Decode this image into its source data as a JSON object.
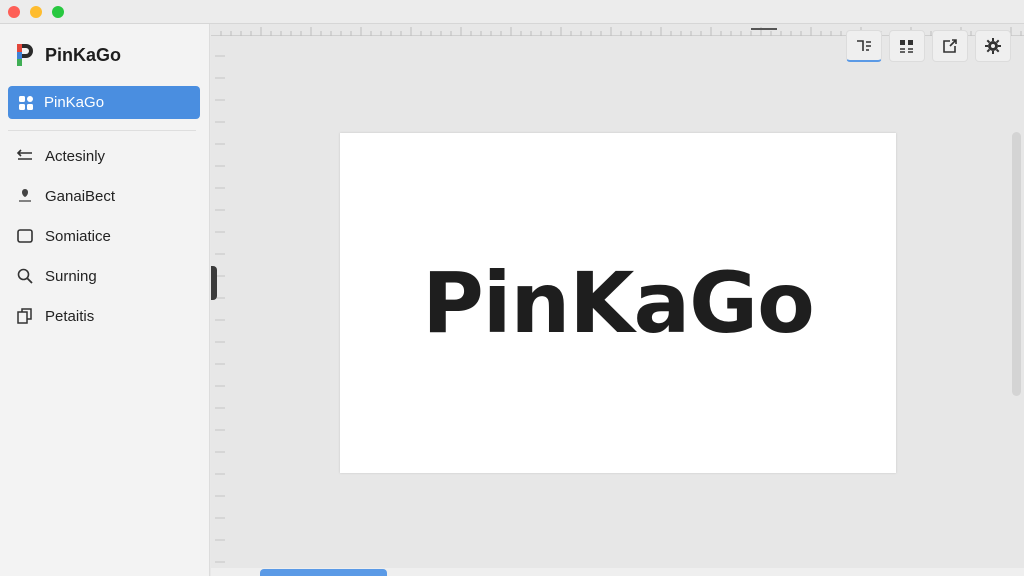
{
  "app": {
    "name": "PinKaGo"
  },
  "sidebar": {
    "active": {
      "label": "PinKaGo",
      "icon": "grid-icon"
    },
    "items": [
      {
        "label": "Actesinly",
        "icon": "arrow-left-lines-icon"
      },
      {
        "label": "GanaiBect",
        "icon": "pin-icon"
      },
      {
        "label": "Somiatice",
        "icon": "square-icon"
      },
      {
        "label": "Surning",
        "icon": "search-icon"
      },
      {
        "label": "Petaitis",
        "icon": "copy-icon"
      }
    ]
  },
  "canvas": {
    "text": "PinKaGo"
  },
  "toolbar": {
    "buttons": [
      {
        "icon": "text-align-icon",
        "active": true
      },
      {
        "icon": "columns-icon",
        "active": false
      },
      {
        "icon": "export-icon",
        "active": false
      },
      {
        "icon": "gear-icon",
        "active": false
      }
    ]
  },
  "colors": {
    "accent": "#4a8ee0",
    "sidebar_bg": "#f3f3f3",
    "workspace_bg": "#e7e7e7",
    "canvas_bg": "#ffffff"
  }
}
